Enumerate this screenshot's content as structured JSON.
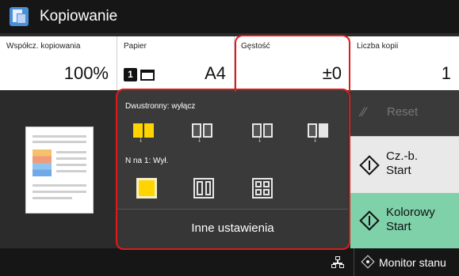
{
  "header": {
    "title": "Kopiowanie",
    "icon": "copy-app-icon"
  },
  "info": {
    "zoom": {
      "label": "Współcz. kopiowania",
      "value": "100%"
    },
    "paper": {
      "label": "Papier",
      "tray": "1",
      "value": "A4"
    },
    "density": {
      "label": "Gęstość",
      "value": "±0"
    },
    "copies": {
      "label": "Liczba kopii",
      "value": "1"
    }
  },
  "options": {
    "duplex_label": "Dwustronny: wyłącz",
    "nup_label": "N na 1: Wył.",
    "more_settings": "Inne ustawienia"
  },
  "actions": {
    "reset": "Reset",
    "bw_start_line1": "Cz.-b.",
    "bw_start_line2": "Start",
    "color_start_line1": "Kolorowy",
    "color_start_line2": "Start"
  },
  "status": {
    "monitor": "Monitor stanu"
  },
  "colors": {
    "accent_yellow": "#ffd400",
    "color_start": "#7fd1aa",
    "highlight": "#e01a1a"
  }
}
